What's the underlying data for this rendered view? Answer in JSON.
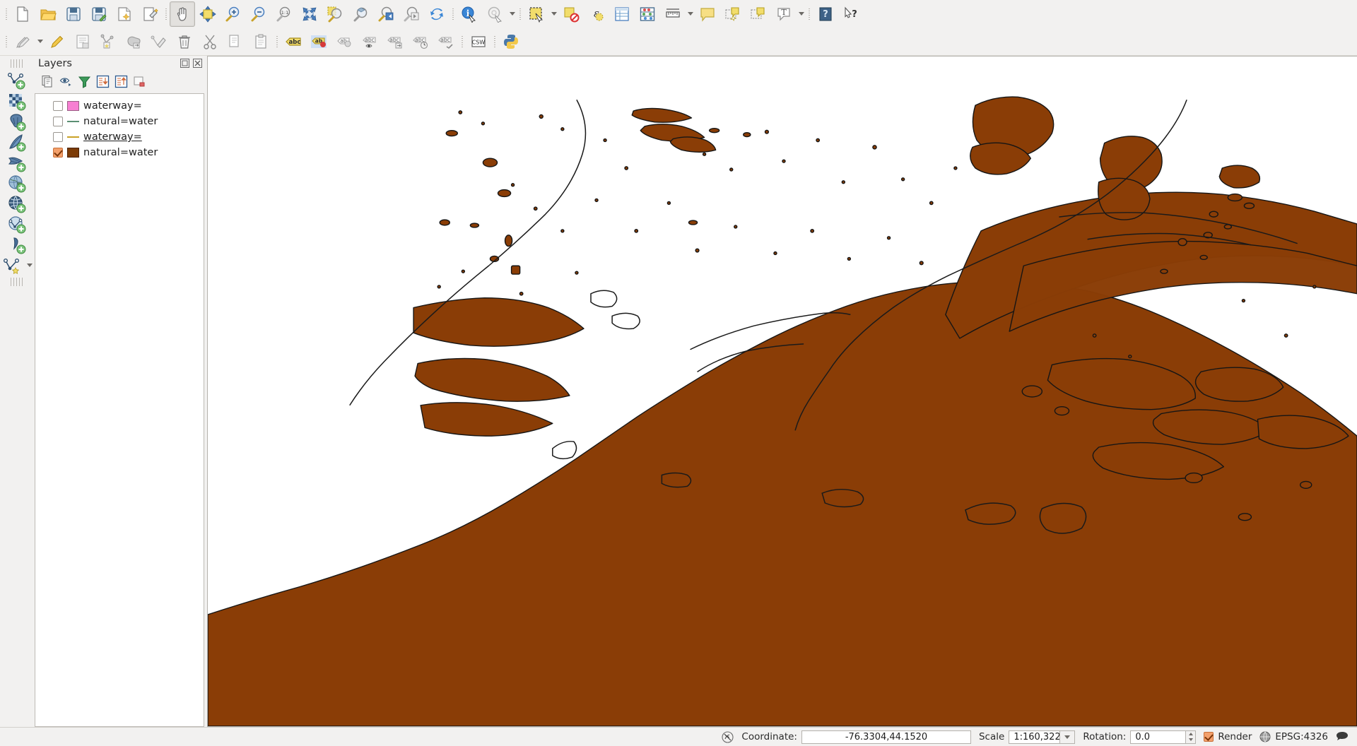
{
  "app": {
    "title": "QGIS"
  },
  "toolbars": {
    "row1": [
      {
        "name": "new-project-button",
        "icon": "new-document-icon",
        "sep_before": true
      },
      {
        "name": "open-project-button",
        "icon": "open-folder-icon"
      },
      {
        "name": "save-project-button",
        "icon": "save-disk-icon"
      },
      {
        "name": "save-project-as-button",
        "icon": "save-as-disk-icon"
      },
      {
        "name": "new-print-layout-button",
        "icon": "new-layout-icon"
      },
      {
        "name": "layout-manager-button",
        "icon": "layout-manager-icon"
      },
      {
        "name": "pan-map-button",
        "icon": "pan-hand-icon",
        "sep_before": true,
        "active": true
      },
      {
        "name": "pan-to-selection-button",
        "icon": "pan-selection-icon"
      },
      {
        "name": "zoom-in-button",
        "icon": "zoom-in-icon"
      },
      {
        "name": "zoom-out-button",
        "icon": "zoom-out-icon"
      },
      {
        "name": "zoom-native-button",
        "icon": "zoom-actual-size-icon"
      },
      {
        "name": "zoom-full-button",
        "icon": "zoom-full-extent-icon"
      },
      {
        "name": "zoom-to-selection-button",
        "icon": "zoom-selection-icon"
      },
      {
        "name": "zoom-to-layer-button",
        "icon": "zoom-layer-icon"
      },
      {
        "name": "zoom-last-button",
        "icon": "zoom-last-icon"
      },
      {
        "name": "zoom-next-button",
        "icon": "zoom-next-icon"
      },
      {
        "name": "refresh-button",
        "icon": "refresh-icon"
      },
      {
        "name": "identify-features-button",
        "icon": "identify-info-icon",
        "sep_before": true
      },
      {
        "name": "run-feature-action-button",
        "icon": "feature-action-icon"
      },
      {
        "name": "select-features-button",
        "icon": "select-rectangle-icon",
        "sep_before_dots": true
      },
      {
        "name": "deselect-features-button",
        "icon": "deselect-features-icon"
      },
      {
        "name": "select-by-expression-button",
        "icon": "select-expression-icon"
      },
      {
        "name": "open-attribute-table-button",
        "icon": "attribute-table-icon"
      },
      {
        "name": "statistical-summary-button",
        "icon": "abacus-statistics-icon"
      },
      {
        "name": "measure-line-button",
        "icon": "measure-ruler-icon"
      },
      {
        "name": "map-tips-button",
        "icon": "map-tip-bubble-icon"
      },
      {
        "name": "new-annotation-button",
        "icon": "new-annotation-icon"
      },
      {
        "name": "move-annotation-button",
        "icon": "move-annotation-icon"
      },
      {
        "name": "text-annotation-button",
        "icon": "text-annotation-icon"
      },
      {
        "name": "help-contents-button",
        "icon": "help-book-icon",
        "sep_before_dots": true
      },
      {
        "name": "whats-this-button",
        "icon": "whats-this-icon"
      }
    ],
    "row2": [
      {
        "name": "current-edits-button",
        "icon": "pencils-edits-icon",
        "sep_before": true
      },
      {
        "name": "toggle-editing-button",
        "icon": "pencil-edit-icon"
      },
      {
        "name": "save-layer-edits-button",
        "icon": "save-layer-edits-icon"
      },
      {
        "name": "add-feature-button",
        "icon": "add-vertex-feature-icon"
      },
      {
        "name": "move-feature-button",
        "icon": "move-feature-icon"
      },
      {
        "name": "node-tool-button",
        "icon": "vertex-tool-icon"
      },
      {
        "name": "delete-selected-button",
        "icon": "trash-delete-icon"
      },
      {
        "name": "cut-features-button",
        "icon": "scissors-cut-icon"
      },
      {
        "name": "copy-features-button",
        "icon": "copy-features-icon"
      },
      {
        "name": "paste-features-button",
        "icon": "paste-features-icon"
      },
      {
        "name": "label-layer-button",
        "icon": "label-abc-icon",
        "sep_before": true
      },
      {
        "name": "highlight-pinned-labels-button",
        "icon": "pinned-label-icon"
      },
      {
        "name": "move-label-button",
        "icon": "move-label-icon"
      },
      {
        "name": "show-hide-labels-button",
        "icon": "show-hide-label-icon"
      },
      {
        "name": "change-label-button",
        "icon": "change-label-icon"
      },
      {
        "name": "rotate-label-button",
        "icon": "rotate-label-icon"
      },
      {
        "name": "pin-labels-button",
        "icon": "pin-label-icon"
      },
      {
        "name": "metasearch-button",
        "icon": "csw-catalog-icon",
        "sep_before": true
      },
      {
        "name": "python-console-button",
        "icon": "python-console-icon",
        "sep_before": true
      }
    ],
    "left": [
      {
        "name": "add-vector-layer-button",
        "icon": "add-vector-layer-icon"
      },
      {
        "name": "add-raster-layer-button",
        "icon": "add-raster-layer-icon"
      },
      {
        "name": "add-postgis-layer-button",
        "icon": "add-postgis-layer-icon"
      },
      {
        "name": "add-spatialite-layer-button",
        "icon": "add-spatialite-layer-icon"
      },
      {
        "name": "add-mssql-layer-button",
        "icon": "add-mssql-layer-icon"
      },
      {
        "name": "add-wms-layer-button",
        "icon": "add-wms-layer-icon"
      },
      {
        "name": "add-wcs-layer-button",
        "icon": "add-wcs-layer-icon"
      },
      {
        "name": "add-wfs-layer-button",
        "icon": "add-wfs-layer-icon"
      },
      {
        "name": "add-delimited-text-layer-button",
        "icon": "add-delimited-text-icon"
      },
      {
        "name": "new-shapefile-layer-button",
        "icon": "new-shapefile-layer-icon"
      }
    ]
  },
  "layers_panel": {
    "title": "Layers",
    "window_buttons": [
      {
        "name": "panel-float-button",
        "icon": "float-panel-icon"
      },
      {
        "name": "panel-close-button",
        "icon": "close-panel-icon"
      }
    ],
    "toolbar": [
      {
        "name": "open-layer-styling-button",
        "icon": "layer-styling-icon"
      },
      {
        "name": "manage-map-themes-button",
        "icon": "eye-themes-icon"
      },
      {
        "name": "filter-legend-button",
        "icon": "filter-funnel-icon"
      },
      {
        "name": "expand-all-button",
        "icon": "expand-all-icon"
      },
      {
        "name": "collapse-all-button",
        "icon": "collapse-all-icon"
      },
      {
        "name": "remove-layer-button",
        "icon": "remove-layer-icon"
      }
    ],
    "layers": [
      {
        "label": "waterway=",
        "checked": false,
        "symbol": "polygon",
        "color": "#f77fd2",
        "selected": false
      },
      {
        "label": "natural=water",
        "checked": false,
        "symbol": "line",
        "color": "#5b8f73",
        "selected": false
      },
      {
        "label": "waterway=",
        "checked": false,
        "symbol": "line",
        "color": "#c9a227",
        "selected": true
      },
      {
        "label": "natural=water",
        "checked": true,
        "symbol": "polygon",
        "color": "#7c3b06",
        "selected": false
      }
    ]
  },
  "map": {
    "water_fill": "#8a3d06",
    "water_stroke": "#1a1a1a",
    "background": "#ffffff"
  },
  "statusbar": {
    "locator_icon": "locator-icon",
    "coordinate_label": "Coordinate:",
    "coordinate_value": "-76.3304,44.1520",
    "scale_label": "Scale",
    "scale_value": "1:160,322",
    "rotation_label": "Rotation:",
    "rotation_value": "0.0",
    "render_label": "Render",
    "render_checked": true,
    "crs_label": "EPSG:4326",
    "crs_icon": "crs-globe-icon",
    "messages_icon": "messages-bubble-icon"
  }
}
